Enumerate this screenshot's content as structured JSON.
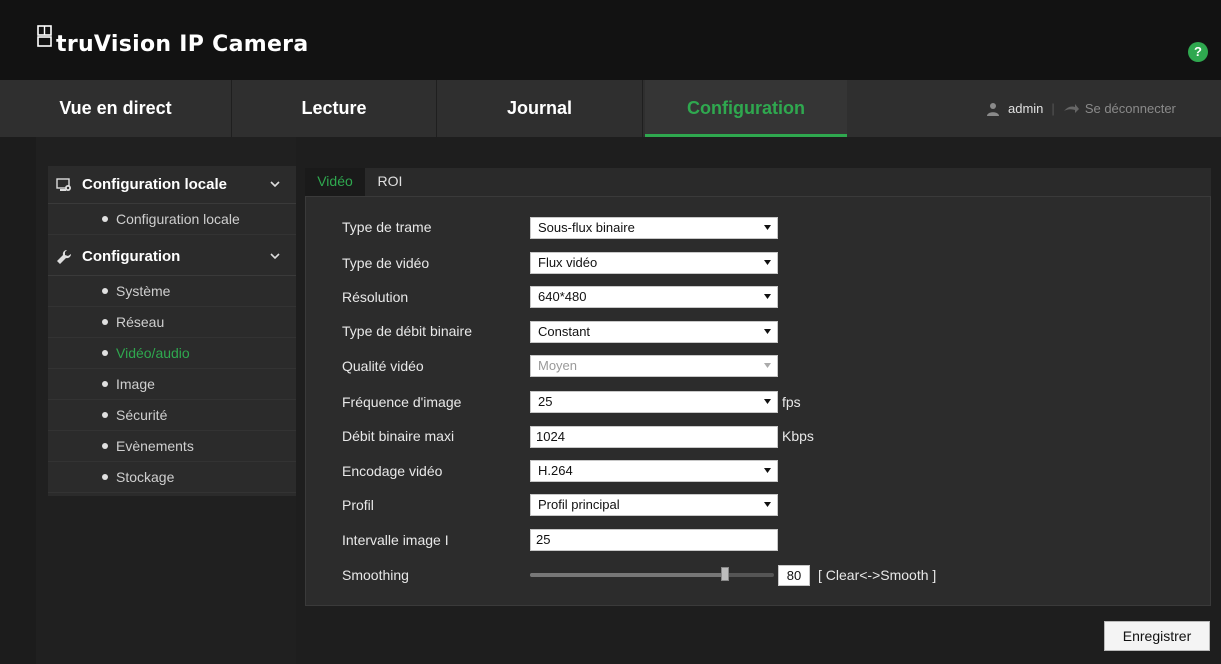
{
  "header": {
    "app_title": "truVision IP Camera",
    "help_symbol": "?"
  },
  "nav": {
    "tabs": [
      {
        "label": "Vue en direct"
      },
      {
        "label": "Lecture"
      },
      {
        "label": "Journal"
      },
      {
        "label": "Configuration",
        "active": true
      }
    ],
    "user": "admin",
    "separator": "|",
    "logout": "Se déconnecter"
  },
  "sidebar": {
    "sections": [
      {
        "title": "Configuration locale",
        "items": [
          "Configuration locale"
        ]
      },
      {
        "title": "Configuration",
        "items": [
          "Système",
          "Réseau",
          "Vidéo/audio",
          "Image",
          "Sécurité",
          "Evènements",
          "Stockage"
        ]
      }
    ],
    "active_item": "Vidéo/audio"
  },
  "tabs": [
    {
      "label": "Vidéo",
      "active": true
    },
    {
      "label": "ROI"
    }
  ],
  "form": {
    "stream_type": {
      "label": "Type de trame",
      "value": "Sous-flux binaire"
    },
    "video_type": {
      "label": "Type de vidéo",
      "value": "Flux vidéo"
    },
    "resolution": {
      "label": "Résolution",
      "value": "640*480"
    },
    "bitrate_type": {
      "label": "Type de débit binaire",
      "value": "Constant"
    },
    "video_quality": {
      "label": "Qualité vidéo",
      "value": "Moyen",
      "disabled": true
    },
    "frame_rate": {
      "label": "Fréquence d'image",
      "value": "25",
      "unit": "fps"
    },
    "max_bitrate": {
      "label": "Débit binaire maxi",
      "value": "1024",
      "unit": "Kbps"
    },
    "video_encoding": {
      "label": "Encodage vidéo",
      "value": "H.264"
    },
    "profile": {
      "label": "Profil",
      "value": "Profil principal"
    },
    "i_frame_interval": {
      "label": "Intervalle image I",
      "value": "25"
    },
    "smoothing": {
      "label": "Smoothing",
      "value": "80",
      "hint": "[ Clear<->Smooth ]",
      "level": 0.8
    }
  },
  "actions": {
    "save_label": "Enregistrer"
  },
  "colors": {
    "accent": "#2fa84f",
    "background": "#1c1c1c",
    "panel": "#2c2c2c"
  }
}
